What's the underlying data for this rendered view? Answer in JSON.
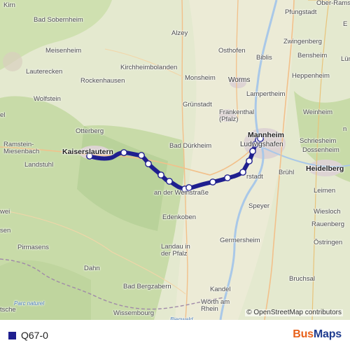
{
  "map": {
    "places": [
      {
        "id": "kirn",
        "label": "Kirn"
      },
      {
        "id": "bad-sobernheim",
        "label": "Bad Sobernheim"
      },
      {
        "id": "meisenheim",
        "label": "Meisenheim"
      },
      {
        "id": "lauterecken",
        "label": "Lauterecken"
      },
      {
        "id": "rockenhausen",
        "label": "Rockenhausen"
      },
      {
        "id": "wolfstein",
        "label": "Wolfstein"
      },
      {
        "id": "otterberg",
        "label": "Otterberg"
      },
      {
        "id": "ramstein",
        "label": "Ramstein-\nMiesenbach"
      },
      {
        "id": "landstuhl",
        "label": "Landstuhl"
      },
      {
        "id": "kaiserslautern",
        "label": "Kaiserslautern"
      },
      {
        "id": "alzey",
        "label": "Alzey"
      },
      {
        "id": "osthofen",
        "label": "Osthofen"
      },
      {
        "id": "kirchheimbolanden",
        "label": "Kirchheimbolanden"
      },
      {
        "id": "monsheim",
        "label": "Monsheim"
      },
      {
        "id": "worms",
        "label": "Worms"
      },
      {
        "id": "gruenstadt",
        "label": "Grünstadt"
      },
      {
        "id": "frankenthal",
        "label": "Frankenthal\n(Pfalz)"
      },
      {
        "id": "bad-duerkheim",
        "label": "Bad Dürkheim"
      },
      {
        "id": "neustadt",
        "label": "an der Weinstraße"
      },
      {
        "id": "mannheim",
        "label": "Mannheim"
      },
      {
        "id": "ludwigshafen",
        "label": "Ludwigshafen"
      },
      {
        "id": "heidelberg",
        "label": "Heidelberg"
      },
      {
        "id": "schriesheim",
        "label": "Schriesheim"
      },
      {
        "id": "dossenheim",
        "label": "Dossenheim"
      },
      {
        "id": "weinheim",
        "label": "Weinheim"
      },
      {
        "id": "lampertheim",
        "label": "Lampertheim"
      },
      {
        "id": "biblis",
        "label": "Biblis"
      },
      {
        "id": "pfungstadt",
        "label": "Pfungstadt"
      },
      {
        "id": "ober-ramstadt",
        "label": "Ober-Ramsta"
      },
      {
        "id": "zwingenberg",
        "label": "Zwingenberg"
      },
      {
        "id": "bensheim",
        "label": "Bensheim"
      },
      {
        "id": "heppenheim",
        "label": "Heppenheim"
      },
      {
        "id": "bruehl",
        "label": "Brühl"
      },
      {
        "id": "schifferstadt",
        "label": "rstadt"
      },
      {
        "id": "speyer",
        "label": "Speyer"
      },
      {
        "id": "leimen",
        "label": "Leimen"
      },
      {
        "id": "wiesloch",
        "label": "Wiesloch"
      },
      {
        "id": "rauenberg",
        "label": "Rauenberg"
      },
      {
        "id": "oestringen",
        "label": "Östringen"
      },
      {
        "id": "edenkoben",
        "label": "Edenkoben"
      },
      {
        "id": "landau",
        "label": "Landau in\nder Pfalz"
      },
      {
        "id": "germersheim",
        "label": "Germersheim"
      },
      {
        "id": "pirmasens",
        "label": "Pirmasens"
      },
      {
        "id": "dahn",
        "label": "Dahn"
      },
      {
        "id": "bad-bergzabern",
        "label": "Bad Bergzabern"
      },
      {
        "id": "kandel",
        "label": "Kandel"
      },
      {
        "id": "woerth",
        "label": "Wörth am\nRhein"
      },
      {
        "id": "wissembourg",
        "label": "Wissembourg"
      },
      {
        "id": "bruchsal",
        "label": "Bruchsal"
      },
      {
        "id": "bienwald",
        "label": "Bienwald"
      },
      {
        "id": "parc-naturel",
        "label": "Parc naturel"
      },
      {
        "id": "el",
        "label": "el"
      },
      {
        "id": "wei",
        "label": "wei"
      },
      {
        "id": "sen",
        "label": "sen"
      },
      {
        "id": "tsche",
        "label": "tsche"
      },
      {
        "id": "lun",
        "label": "Lün"
      },
      {
        "id": "e-edge",
        "label": "E"
      },
      {
        "id": "n-edge",
        "label": "n"
      }
    ]
  },
  "attribution": "© OpenStreetMap contributors",
  "legend": {
    "route_name": "Q67-0",
    "route_color": "#1f1f8f"
  },
  "brand": {
    "part1": "Bus",
    "part2": "Maps",
    "color1": "#e8611a",
    "color2": "#1f3c8f"
  }
}
